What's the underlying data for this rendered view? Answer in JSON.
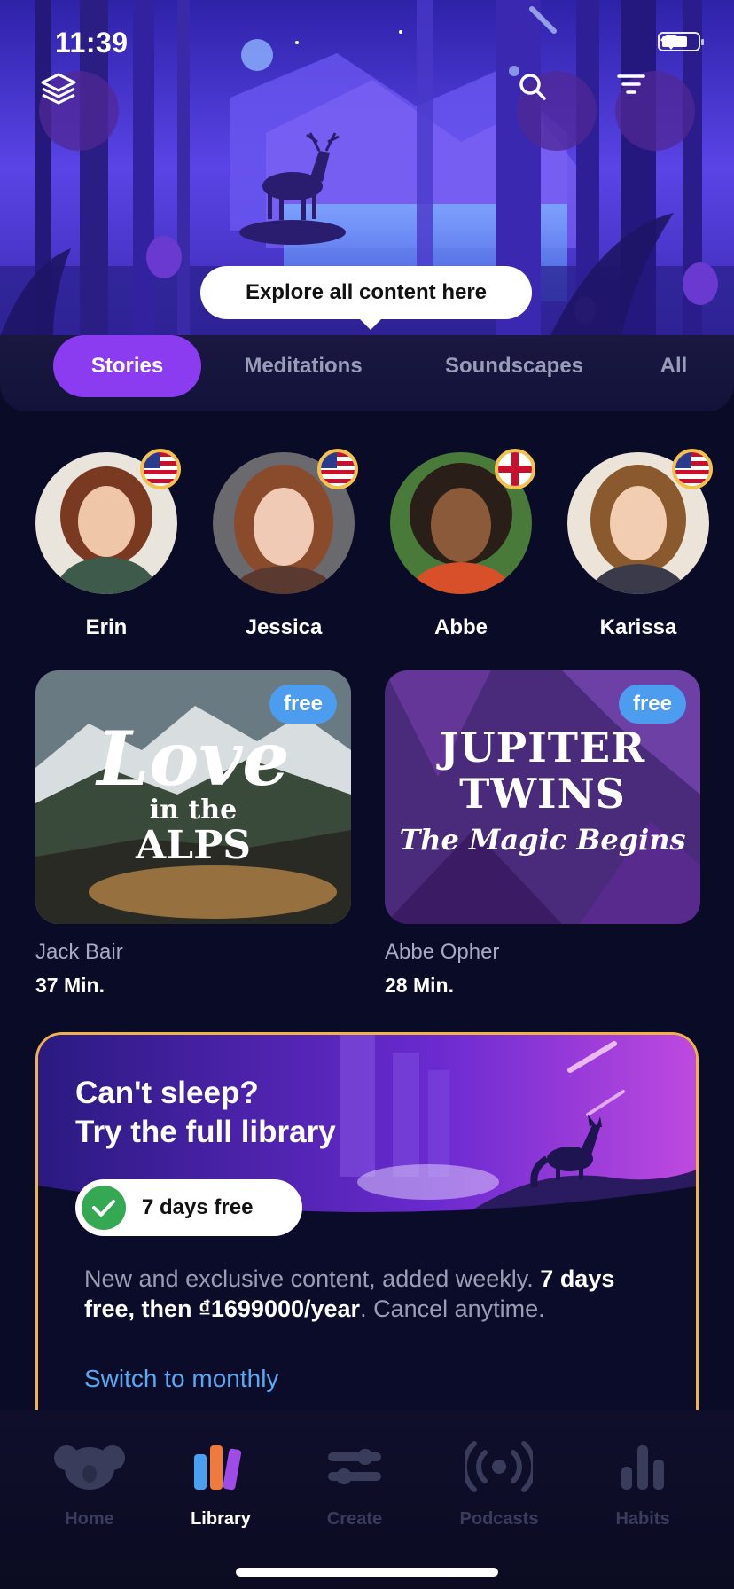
{
  "status": {
    "time": "11:39"
  },
  "hero": {
    "tooltip": "Explore all content here",
    "icons": [
      "layers-icon",
      "search-icon",
      "filter-icon"
    ]
  },
  "tabs": [
    {
      "label": "Stories",
      "active": true
    },
    {
      "label": "Meditations",
      "active": false
    },
    {
      "label": "Soundscapes",
      "active": false
    },
    {
      "label": "All",
      "active": false
    }
  ],
  "narrators": [
    {
      "name": "Erin",
      "flag": "us-flag-icon"
    },
    {
      "name": "Jessica",
      "flag": "us-flag-icon"
    },
    {
      "name": "Abbe",
      "flag": "england-flag-icon"
    },
    {
      "name": "Karissa",
      "flag": "us-flag-icon"
    }
  ],
  "stories": [
    {
      "badge": "free",
      "cover_title_line1": "Love",
      "cover_title_line2": "in the",
      "cover_title_line3": "ALPS",
      "author": "Jack Bair",
      "duration": "37 Min."
    },
    {
      "badge": "free",
      "cover_title_line1": "JUPITER",
      "cover_title_line2": "TWINS",
      "cover_title_line3": "The Magic Begins",
      "author": "Abbe Opher",
      "duration": "28 Min."
    }
  ],
  "promo": {
    "title_line1": "Can't sleep?",
    "title_line2": "Try the full library",
    "trial_label": "7 days free",
    "desc_plain": "New and exclusive content, added weekly. ",
    "desc_bold": "7 days free, then ₫1699000/year",
    "desc_tail": ". Cancel anytime.",
    "switch_label": "Switch to monthly"
  },
  "bottom_nav": [
    {
      "label": "Home",
      "icon": "koala-icon",
      "active": false
    },
    {
      "label": "Library",
      "icon": "books-icon",
      "active": true
    },
    {
      "label": "Create",
      "icon": "sliders-icon",
      "active": false
    },
    {
      "label": "Podcasts",
      "icon": "podcast-icon",
      "active": false
    },
    {
      "label": "Habits",
      "icon": "bar-chart-icon",
      "active": false
    }
  ],
  "colors": {
    "accent": "#8b3cf0",
    "badge": "#4c9cf0",
    "promo_border": "#f0b24a",
    "link": "#5aa8f0",
    "background": "#0a0b26"
  }
}
